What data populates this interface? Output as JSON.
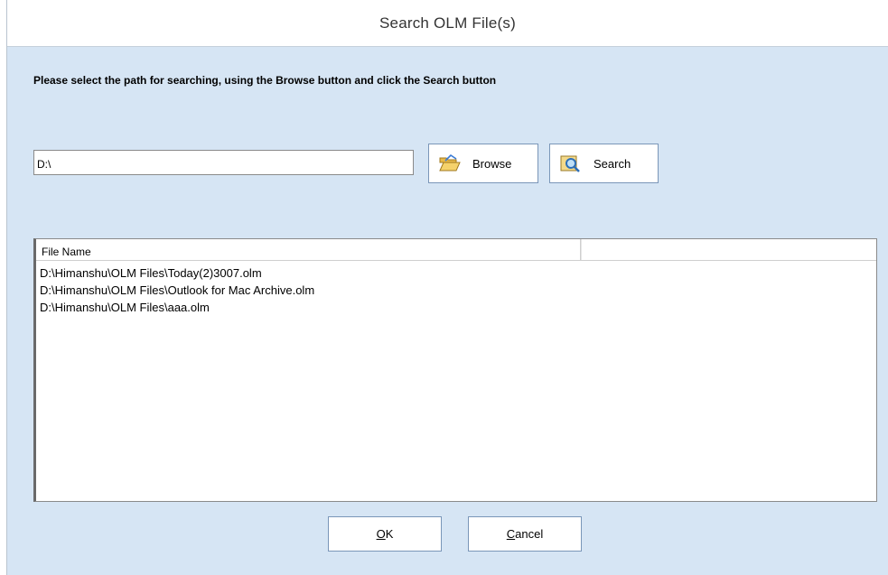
{
  "window": {
    "title": "Search OLM File(s)"
  },
  "instruction": "Please select the path for searching, using the Browse button and click the Search button",
  "path": {
    "value": "D:\\"
  },
  "buttons": {
    "browse": {
      "label": "Browse",
      "icon": "folder-open-icon"
    },
    "search": {
      "label": "Search",
      "icon": "search-icon"
    },
    "ok": {
      "mnemonic": "O",
      "rest": "K"
    },
    "cancel": {
      "mnemonic": "C",
      "rest": "ancel"
    }
  },
  "list": {
    "columns": [
      "File Name",
      ""
    ],
    "rows": [
      "D:\\Himanshu\\OLM Files\\Today(2)3007.olm",
      "D:\\Himanshu\\OLM Files\\Outlook for Mac Archive.olm",
      "D:\\Himanshu\\OLM Files\\aaa.olm"
    ]
  }
}
